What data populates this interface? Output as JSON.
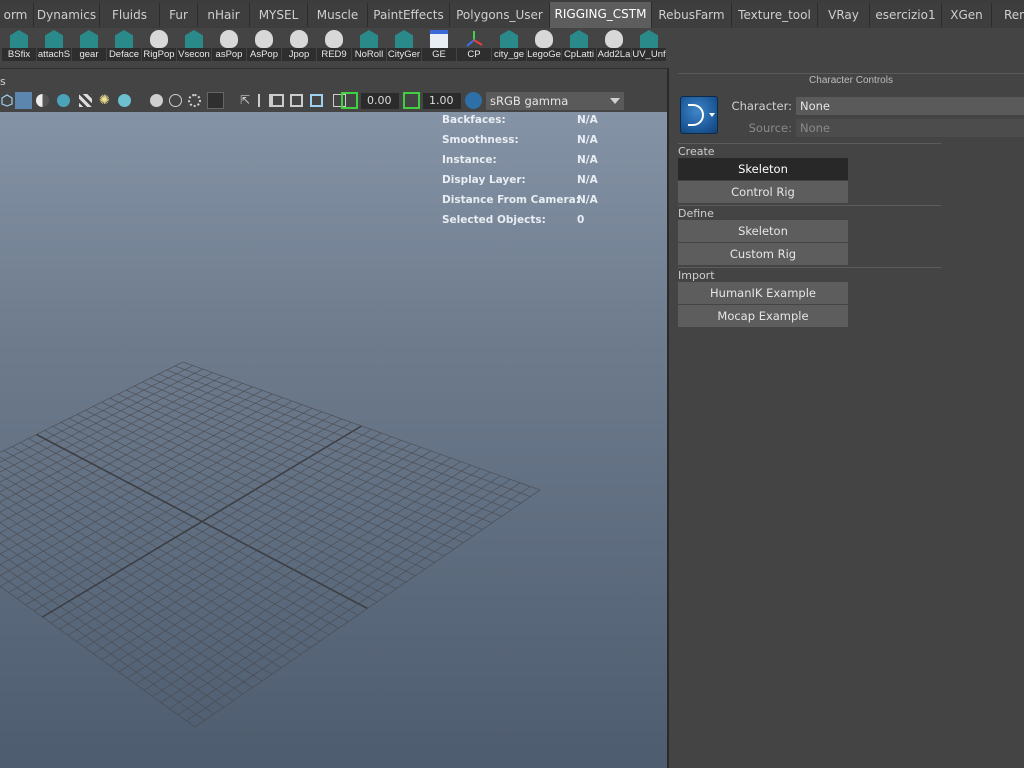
{
  "shelf_tabs": [
    {
      "label": "orm"
    },
    {
      "label": "Dynamics"
    },
    {
      "label": "Fluids"
    },
    {
      "label": "Fur"
    },
    {
      "label": "nHair"
    },
    {
      "label": "MYSEL"
    },
    {
      "label": "Muscle"
    },
    {
      "label": "PaintEffects"
    },
    {
      "label": "Polygons_User"
    },
    {
      "label": "RIGGING_CSTM",
      "active": true
    },
    {
      "label": "RebusFarm"
    },
    {
      "label": "Texture_tool"
    },
    {
      "label": "VRay"
    },
    {
      "label": "esercizio1"
    },
    {
      "label": "XGen"
    },
    {
      "label": "Ren"
    }
  ],
  "shelf_buttons": [
    {
      "label": "BSfix",
      "icon": "mel-icon"
    },
    {
      "label": "attachS",
      "icon": "mel-icon"
    },
    {
      "label": "gear",
      "icon": "mel-icon"
    },
    {
      "label": "Deface",
      "icon": "mel-icon"
    },
    {
      "label": "RigPop",
      "icon": "python-icon"
    },
    {
      "label": "Vsecon",
      "icon": "mel-icon"
    },
    {
      "label": "asPop",
      "icon": "python-icon"
    },
    {
      "label": "AsPop",
      "icon": "python-icon"
    },
    {
      "label": "Jpop",
      "icon": "python-icon"
    },
    {
      "label": "RED9",
      "icon": "python-icon"
    },
    {
      "label": "NoRoll",
      "icon": "mel-icon"
    },
    {
      "label": "CityGer",
      "icon": "mel-icon"
    },
    {
      "label": "GE",
      "icon": "window-icon"
    },
    {
      "label": "CP",
      "icon": "axis-icon"
    },
    {
      "label": "city_ge",
      "icon": "mel-icon"
    },
    {
      "label": "LegoGe",
      "icon": "python-icon"
    },
    {
      "label": "CpLatti",
      "icon": "mel-icon"
    },
    {
      "label": "Add2La",
      "icon": "python-icon"
    },
    {
      "label": "UV_Unf",
      "icon": "mel-icon"
    }
  ],
  "viewport": {
    "menu_fragment": "s",
    "exposure_value": "0.00",
    "gamma_value": "1.00",
    "color_management": "sRGB gamma",
    "hud": [
      {
        "key": "Backfaces:",
        "value": "N/A"
      },
      {
        "key": "Smoothness:",
        "value": "N/A"
      },
      {
        "key": "Instance:",
        "value": "N/A"
      },
      {
        "key": "Display Layer:",
        "value": "N/A"
      },
      {
        "key": "Distance From Camera:",
        "value": "N/A"
      },
      {
        "key": "Selected Objects:",
        "value": "0"
      }
    ]
  },
  "panel": {
    "title": "Character Controls",
    "character_label": "Character:",
    "character_value": "None",
    "source_label": "Source:",
    "source_value": "None",
    "sections": {
      "create": {
        "label": "Create",
        "buttons": [
          "Skeleton",
          "Control Rig"
        ]
      },
      "define": {
        "label": "Define",
        "buttons": [
          "Skeleton",
          "Custom Rig"
        ]
      },
      "import": {
        "label": "Import",
        "buttons": [
          "HumanIK Example",
          "Mocap Example"
        ]
      }
    }
  },
  "colors": {
    "viewport_top": "#8593a6",
    "viewport_bottom": "#4d5c6e",
    "grid": "#4a4a50",
    "accent_icon": "#2a8a8a"
  }
}
